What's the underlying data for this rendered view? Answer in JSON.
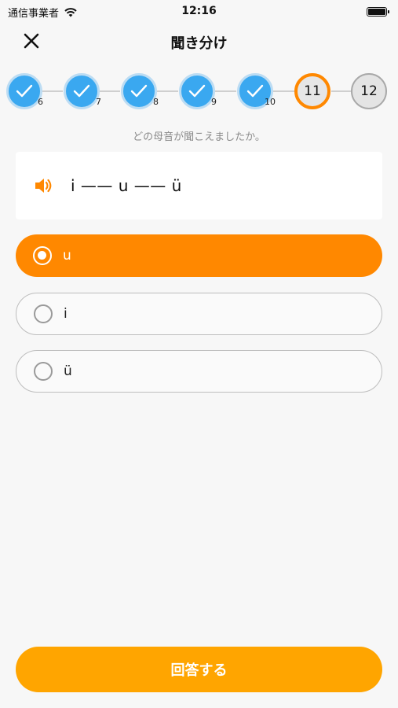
{
  "status_bar": {
    "carrier": "通信事業者",
    "time": "12:16",
    "wifi_icon": "wifi-icon",
    "battery_icon": "battery-icon"
  },
  "nav": {
    "title": "聞き分け",
    "close_icon": "close-icon"
  },
  "stepper": {
    "steps": [
      {
        "label": "6",
        "state": "done"
      },
      {
        "label": "7",
        "state": "done"
      },
      {
        "label": "8",
        "state": "done"
      },
      {
        "label": "9",
        "state": "done"
      },
      {
        "label": "10",
        "state": "done"
      },
      {
        "label": "11",
        "state": "current"
      },
      {
        "label": "12",
        "state": "todo"
      }
    ]
  },
  "question": "どの母音が聞こえましたか。",
  "prompt": {
    "icon": "speaker-icon",
    "text": "i —— u —— ü"
  },
  "options": [
    {
      "label": "u",
      "selected": true
    },
    {
      "label": "i",
      "selected": false
    },
    {
      "label": "ü",
      "selected": false
    }
  ],
  "submit_label": "回答する",
  "colors": {
    "accent": "#ff8800",
    "submit": "#ffa500",
    "done_step": "#3aa8f0"
  }
}
